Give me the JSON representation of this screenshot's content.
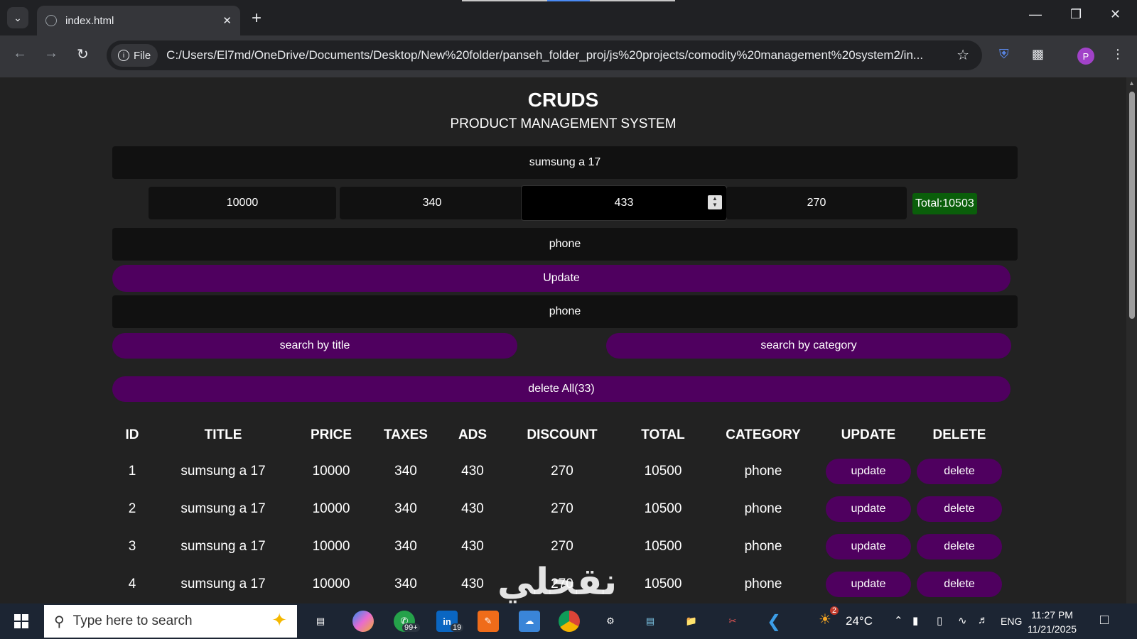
{
  "browser": {
    "tab_title": "index.html",
    "file_chip": "File",
    "url": "C:/Users/El7md/OneDrive/Documents/Desktop/New%20folder/panseh_folder_proj/js%20projects/comodity%20management%20system2/in...",
    "profile_initial": "P"
  },
  "page": {
    "title": "CRUDS",
    "subtitle": "PRODUCT MANAGEMENT SYSTEM",
    "form": {
      "title_value": "sumsung a 17",
      "price_value": "10000",
      "taxes_value": "340",
      "ads_value": "433",
      "discount_value": "270",
      "total_label": "Total:10503",
      "category_value": "phone",
      "submit_label": "Update",
      "search_value": "phone",
      "search_title_label": "search by title",
      "search_category_label": "search by category",
      "delete_all_label": "delete All(33)"
    },
    "table": {
      "headers": [
        "ID",
        "TITLE",
        "PRICE",
        "TAXES",
        "ADS",
        "DISCOUNT",
        "TOTAL",
        "CATEGORY",
        "UPDATE",
        "DELETE"
      ],
      "update_label": "update",
      "delete_label": "delete",
      "rows": [
        {
          "id": "1",
          "title": "sumsung a 17",
          "price": "10000",
          "taxes": "340",
          "ads": "430",
          "discount": "270",
          "total": "10500",
          "category": "phone"
        },
        {
          "id": "2",
          "title": "sumsung a 17",
          "price": "10000",
          "taxes": "340",
          "ads": "430",
          "discount": "270",
          "total": "10500",
          "category": "phone"
        },
        {
          "id": "3",
          "title": "sumsung a 17",
          "price": "10000",
          "taxes": "340",
          "ads": "430",
          "discount": "270",
          "total": "10500",
          "category": "phone"
        },
        {
          "id": "4",
          "title": "sumsung a 17",
          "price": "10000",
          "taxes": "340",
          "ads": "430",
          "discount": "270",
          "total": "10500",
          "category": "phone"
        }
      ]
    }
  },
  "taskbar": {
    "search_placeholder": "Type here to search",
    "whatsapp_badge": "99+",
    "linkedin_badge": "19",
    "weather_badge": "2",
    "temperature": "24°C",
    "language": "ENG",
    "time": "11:27 PM",
    "date": "11/21/2025",
    "watermark": "نقحلي"
  },
  "colors": {
    "button_purple": "#4f005f",
    "total_green": "#0a5e0a",
    "field_black": "#111111",
    "page_bg": "#222222"
  }
}
